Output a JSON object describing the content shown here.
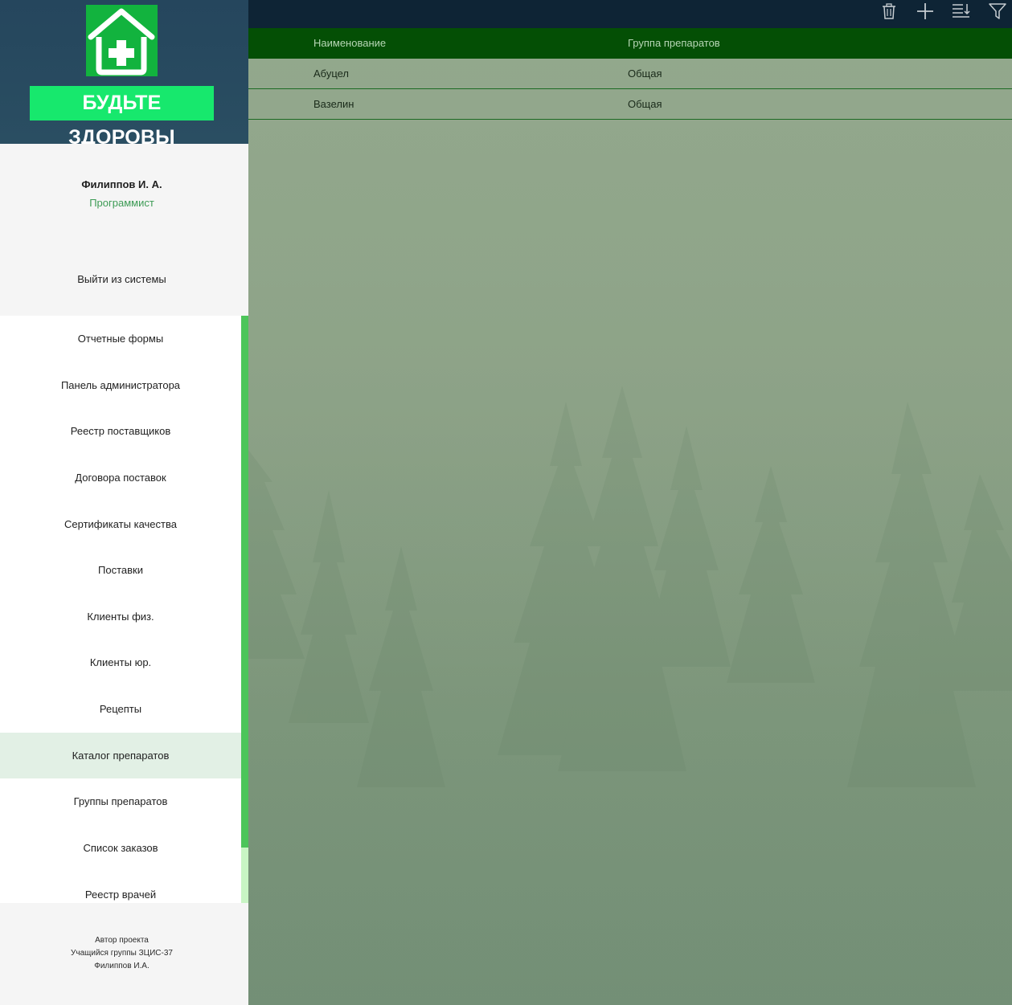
{
  "brand": {
    "name": "БУДЬТЕ ЗДОРОВЫ",
    "logo_icon": "house-medical-cross-icon"
  },
  "user": {
    "name": "Филиппов И. А.",
    "role": "Программист"
  },
  "logout_label": "Выйти из системы",
  "nav": {
    "items": [
      {
        "label": "Отчетные формы"
      },
      {
        "label": "Панель администратора"
      },
      {
        "label": "Реестр поставщиков"
      },
      {
        "label": "Договора поставок"
      },
      {
        "label": "Сертификаты качества"
      },
      {
        "label": "Поставки"
      },
      {
        "label": "Клиенты физ."
      },
      {
        "label": "Клиенты юр."
      },
      {
        "label": "Рецепты"
      },
      {
        "label": "Каталог препаратов"
      },
      {
        "label": "Группы препаратов"
      },
      {
        "label": "Список заказов"
      },
      {
        "label": "Реестр врачей"
      }
    ],
    "active": "Каталог препаратов"
  },
  "footer": {
    "line1": "Автор проекта",
    "line2": "Учащийся группы ЗЦИС-37",
    "line3": "Филиппов И.А."
  },
  "toolbar": {
    "icons": [
      "trash-icon",
      "plus-icon",
      "sort-icon",
      "filter-icon"
    ]
  },
  "table": {
    "columns": [
      "Наименование",
      "Группа препаратов"
    ],
    "rows": [
      [
        "Абуцел",
        "Общая"
      ],
      [
        "Вазелин",
        "Общая"
      ]
    ]
  },
  "colors": {
    "accent": "#17e86d",
    "logo_green": "#12b33e",
    "brand_bg": "#25465d",
    "table_header": "#044f05",
    "toolbar_bg": "#0e2435",
    "scroll_thumb": "#4cc55a",
    "active_item": "#e2f0e5"
  }
}
